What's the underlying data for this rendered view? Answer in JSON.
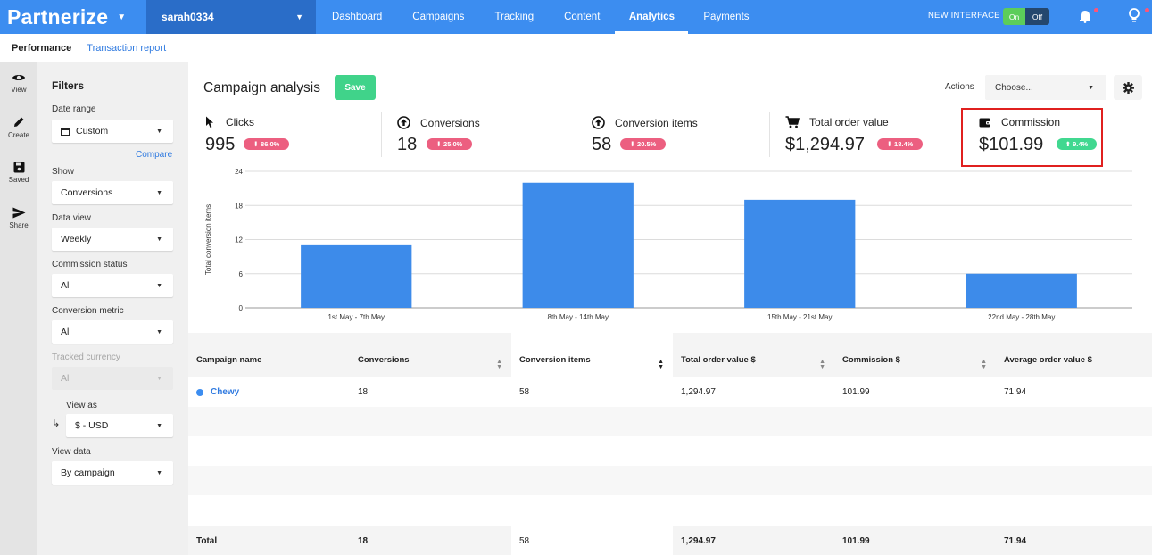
{
  "brand": {
    "logo_text": "Partnerize"
  },
  "account": {
    "name": "sarah0334"
  },
  "nav": {
    "items": [
      "Dashboard",
      "Campaigns",
      "Tracking",
      "Content",
      "Analytics",
      "Payments"
    ],
    "active": "Analytics"
  },
  "new_interface": {
    "label": "NEW INTERFACE",
    "on": "On",
    "off": "Off"
  },
  "subnav": {
    "performance": "Performance",
    "transaction_report": "Transaction report"
  },
  "rail": {
    "view": "View",
    "create": "Create",
    "saved": "Saved",
    "share": "Share"
  },
  "filters": {
    "heading": "Filters",
    "date_range_label": "Date range",
    "date_range_value": "Custom",
    "compare": "Compare",
    "show_label": "Show",
    "show_value": "Conversions",
    "data_view_label": "Data view",
    "data_view_value": "Weekly",
    "commission_status_label": "Commission status",
    "commission_status_value": "All",
    "conversion_metric_label": "Conversion metric",
    "conversion_metric_value": "All",
    "tracked_currency_label": "Tracked currency",
    "tracked_currency_value": "All",
    "view_as_label": "View as",
    "view_as_value": "$ - USD",
    "view_data_label": "View data",
    "view_data_value": "By campaign"
  },
  "header": {
    "title": "Campaign analysis",
    "save": "Save",
    "actions_label": "Actions",
    "actions_placeholder": "Choose..."
  },
  "kpis": [
    {
      "label": "Clicks",
      "value": "995",
      "change": "86.0%",
      "direction": "down",
      "icon": "cursor-icon"
    },
    {
      "label": "Conversions",
      "value": "18",
      "change": "25.0%",
      "direction": "down",
      "icon": "arrow-up-circle-icon"
    },
    {
      "label": "Conversion items",
      "value": "58",
      "change": "20.5%",
      "direction": "down",
      "icon": "arrow-up-circle-icon"
    },
    {
      "label": "Total order value",
      "value": "$1,294.97",
      "change": "18.4%",
      "direction": "down",
      "icon": "cart-icon"
    },
    {
      "label": "Commission",
      "value": "$101.99",
      "change": "9.4%",
      "direction": "up",
      "icon": "wallet-icon"
    }
  ],
  "colors": {
    "primary": "#3c8df0",
    "bar": "#3d8bea",
    "badge_down": "#ec5f80",
    "badge_up": "#41d890",
    "highlight": "#e0201f"
  },
  "chart_data": {
    "type": "bar",
    "categories": [
      "1st May - 7th May",
      "8th May - 14th May",
      "15th May - 21st May",
      "22nd May - 28th May"
    ],
    "values": [
      11,
      22,
      19,
      6
    ],
    "ylabel": "Total conversion items",
    "xlabel": "",
    "ylim": [
      0,
      24
    ],
    "yticks": [
      0,
      6,
      12,
      18,
      24
    ],
    "grid": true
  },
  "table": {
    "columns": [
      "Campaign name",
      "Conversions",
      "Conversion items",
      "Total order value $",
      "Commission $",
      "Average order value $"
    ],
    "rows": [
      [
        "Chewy",
        "18",
        "58",
        "1,294.97",
        "101.99",
        "71.94"
      ]
    ],
    "footer": [
      "Total",
      "18",
      "58",
      "1,294.97",
      "101.99",
      "71.94"
    ]
  }
}
